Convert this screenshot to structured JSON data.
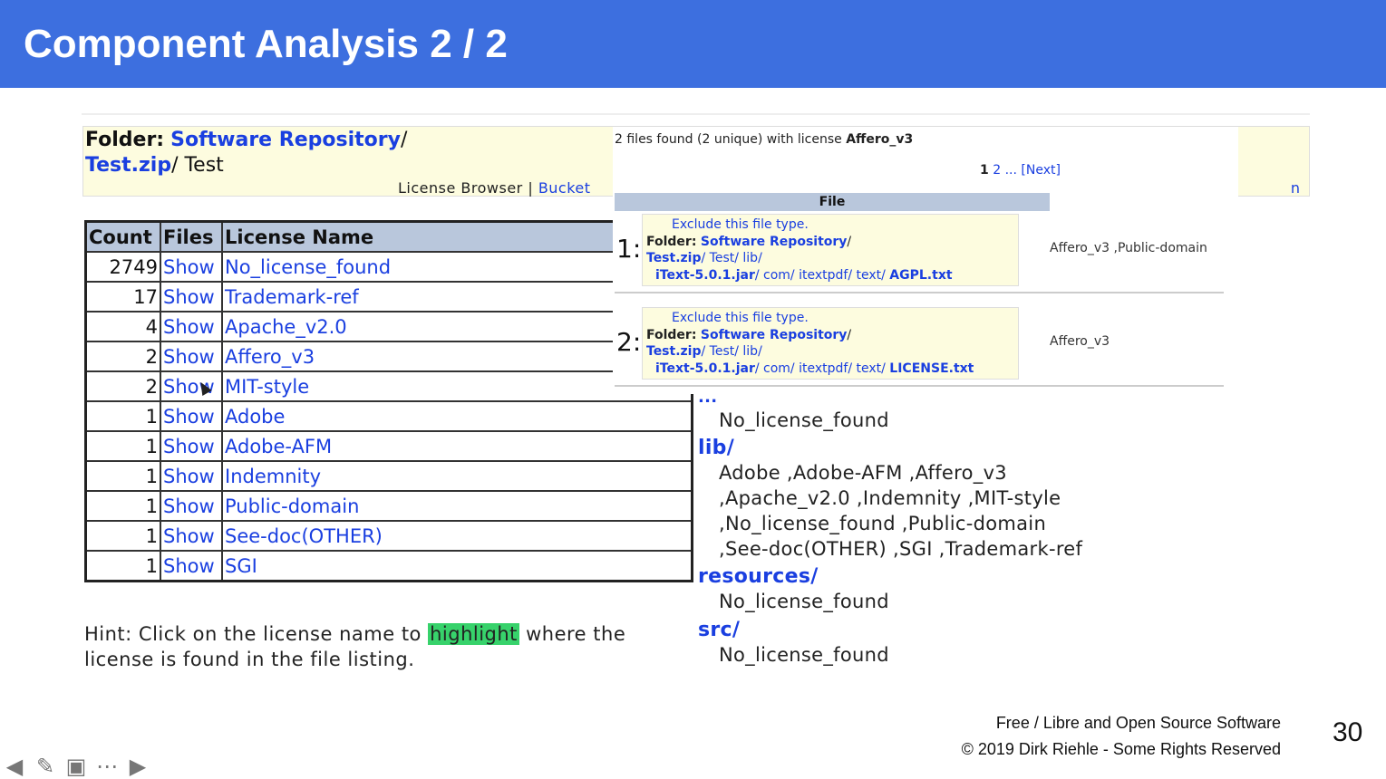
{
  "slide": {
    "title": "Component Analysis 2 / 2",
    "page_number": "30",
    "footer_line1": "Free / Libre and Open Source Software",
    "footer_line2": "© 2019 Dirk Riehle - Some Rights Reserved"
  },
  "folder": {
    "label": "Folder:",
    "repo_link": "Software Repository",
    "sep1": "/",
    "zip_link": "Test.zip",
    "rest": "/ Test",
    "nav_browser": "License Browser",
    "nav_sep": " | ",
    "nav_bucket": "Bucket",
    "nav_edge": "n"
  },
  "table": {
    "headers": [
      "Count",
      "Files",
      "License Name"
    ],
    "rows": [
      {
        "count": "2749",
        "files": "Show",
        "name": "No_license_found"
      },
      {
        "count": "17",
        "files": "Show",
        "name": "Trademark-ref"
      },
      {
        "count": "4",
        "files": "Show",
        "name": "Apache_v2.0"
      },
      {
        "count": "2",
        "files": "Show",
        "name": "Affero_v3"
      },
      {
        "count": "2",
        "files": "Show",
        "name": "MIT-style"
      },
      {
        "count": "1",
        "files": "Show",
        "name": "Adobe"
      },
      {
        "count": "1",
        "files": "Show",
        "name": "Adobe-AFM"
      },
      {
        "count": "1",
        "files": "Show",
        "name": "Indemnity"
      },
      {
        "count": "1",
        "files": "Show",
        "name": "Public-domain"
      },
      {
        "count": "1",
        "files": "Show",
        "name": "See-doc(OTHER)"
      },
      {
        "count": "1",
        "files": "Show",
        "name": "SGI"
      }
    ]
  },
  "hint": {
    "before": "Hint: Click on the license name to",
    "highlight": "highlight",
    "after": "where the license is found in the file listing."
  },
  "tree": {
    "partial": "...",
    "first_license": "No_license_found",
    "lib_dir": "lib/",
    "lib_lines": [
      "Adobe ,Adobe-AFM ,Affero_v3",
      ",Apache_v2.0 ,Indemnity ,MIT-style",
      ",No_license_found ,Public-domain",
      ",See-doc(OTHER) ,SGI ,Trademark-ref"
    ],
    "resources_dir": "resources/",
    "resources_license": "No_license_found",
    "src_dir": "src/",
    "src_license": "No_license_found"
  },
  "popup": {
    "found_text": "2 files found (2 unique) with license",
    "found_license": "Affero_v3",
    "page_current": "1",
    "page_other": "2",
    "page_ellipsis": "...",
    "page_next": "[Next]",
    "file_header": "File",
    "entries": [
      {
        "num": "1:",
        "exclude": "Exclude this file type.",
        "folder_label": "Folder:",
        "repo": "Software Repository",
        "zip": "Test.zip",
        "path1": "/ Test/ lib/",
        "jar": "iText-5.0.1.jar",
        "path2": "/ com/ itextpdf/ text/",
        "file": "AGPL.txt",
        "licenses": "Affero_v3 ,Public-domain"
      },
      {
        "num": "2:",
        "exclude": "Exclude this file type.",
        "folder_label": "Folder:",
        "repo": "Software Repository",
        "zip": "Test.zip",
        "path1": "/ Test/ lib/",
        "jar": "iText-5.0.1.jar",
        "path2": "/ com/ itextpdf/ text/",
        "file": "LICENSE.txt",
        "licenses": "Affero_v3"
      }
    ]
  },
  "nav_icons": [
    "arrow-left-icon",
    "pen-icon",
    "slides-icon",
    "more-icon",
    "arrow-right-icon"
  ],
  "colors": {
    "header_bg": "#3d6fdf",
    "link": "#1a3fe0",
    "highlight": "#37d26b",
    "folder_bg": "#fdfcdf",
    "table_header": "#b9c7dc"
  }
}
